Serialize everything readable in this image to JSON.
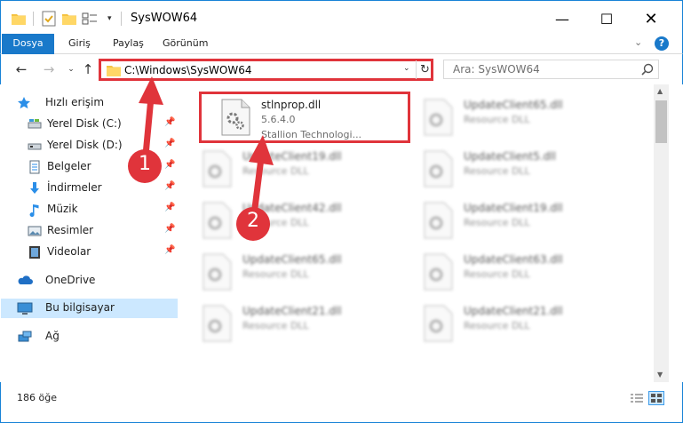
{
  "window": {
    "title": "SysWOW64",
    "controls": {
      "minimize": "—",
      "maximize": "☐",
      "close": "✕"
    }
  },
  "ribbon": {
    "tabs": [
      {
        "label": "Dosya",
        "active": true
      },
      {
        "label": "Giriş"
      },
      {
        "label": "Paylaş"
      },
      {
        "label": "Görünüm"
      }
    ],
    "help": "?"
  },
  "address_bar": {
    "path": "C:\\Windows\\SysWOW64",
    "search_placeholder": "Ara: SysWOW64"
  },
  "nav_pane": {
    "items": [
      {
        "label": "Hızlı erişim",
        "icon": "star-icon",
        "pinned": false
      },
      {
        "label": "Yerel Disk (C:)",
        "icon": "drive-icon",
        "pinned": true
      },
      {
        "label": "Yerel Disk (D:)",
        "icon": "drive-icon",
        "pinned": true
      },
      {
        "label": "Belgeler",
        "icon": "documents-icon",
        "pinned": true
      },
      {
        "label": "İndirmeler",
        "icon": "downloads-icon",
        "pinned": true
      },
      {
        "label": "Müzik",
        "icon": "music-icon",
        "pinned": true
      },
      {
        "label": "Resimler",
        "icon": "pictures-icon",
        "pinned": true
      },
      {
        "label": "Videolar",
        "icon": "videos-icon",
        "pinned": true
      },
      {
        "label": "OneDrive",
        "icon": "cloud-icon",
        "pinned": false
      },
      {
        "label": "Bu bilgisayar",
        "icon": "computer-icon",
        "pinned": false,
        "selected": true
      },
      {
        "label": "Ağ",
        "icon": "network-icon",
        "pinned": false
      }
    ]
  },
  "files": [
    {
      "name": "stlnprop.dll",
      "line2": "5.6.4.0",
      "line3": "Stallion Technologi...",
      "highlighted": true
    },
    {
      "name": "UpdateClient65.dll",
      "line2": "Resource DLL"
    },
    {
      "name": "UpdateClient19.dll",
      "line2": "Resource DLL"
    },
    {
      "name": "UpdateClient5.dll",
      "line2": "Resource DLL"
    },
    {
      "name": "UpdateClient42.dll",
      "line2": "Resource DLL"
    },
    {
      "name": "UpdateClient19.dll",
      "line2": "Resource DLL"
    },
    {
      "name": "UpdateClient65.dll",
      "line2": "Resource DLL"
    },
    {
      "name": "UpdateClient63.dll",
      "line2": "Resource DLL"
    },
    {
      "name": "UpdateClient21.dll",
      "line2": "Resource DLL"
    },
    {
      "name": "UpdateClient21.dll",
      "line2": "Resource DLL"
    }
  ],
  "status": {
    "item_count": "186 öğe"
  },
  "annotations": {
    "step1": "1",
    "step2": "2",
    "color": "#e0343b"
  }
}
